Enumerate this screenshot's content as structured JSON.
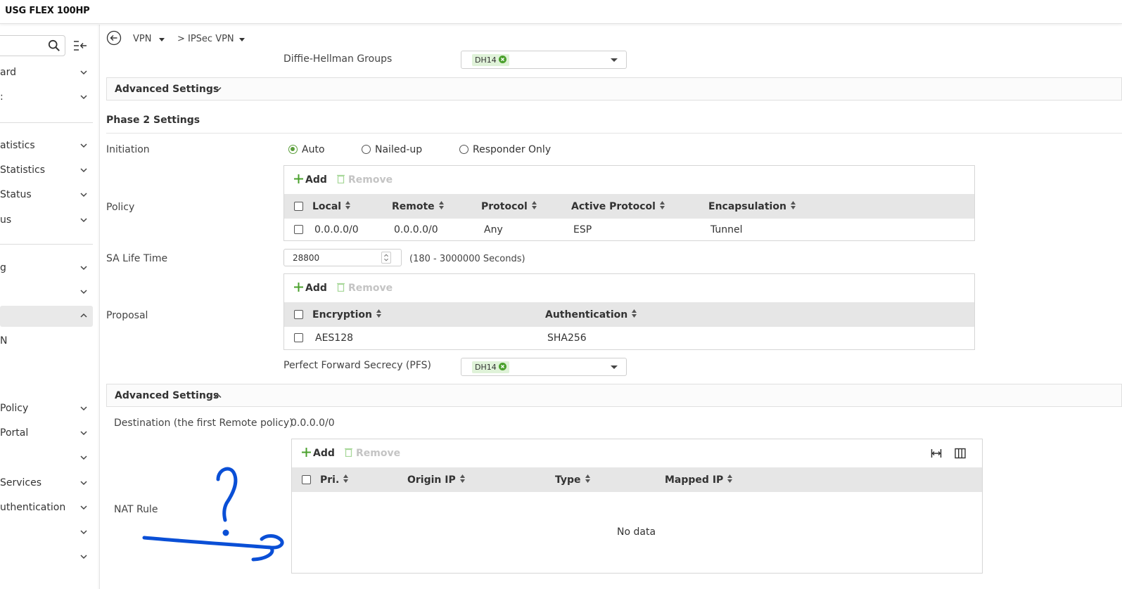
{
  "app": {
    "title": "USG FLEX 100HP"
  },
  "sidebar": {
    "search_placeholder": "",
    "items": [
      {
        "label": "ard",
        "expanded": false
      },
      {
        "label": ":",
        "expanded": false
      },
      {
        "label": "atistics",
        "expanded": false
      },
      {
        "label": "Statistics",
        "expanded": false
      },
      {
        "label": " Status",
        "expanded": false
      },
      {
        "label": "us",
        "expanded": false
      },
      {
        "label": "g",
        "expanded": false
      },
      {
        "label": "",
        "expanded": false
      },
      {
        "label": "",
        "expanded": true,
        "active": true
      },
      {
        "label": "N"
      },
      {
        "label": "Policy",
        "expanded": false
      },
      {
        "label": "Portal",
        "expanded": false
      },
      {
        "label": "",
        "expanded": false
      },
      {
        "label": "Services",
        "expanded": false
      },
      {
        "label": "uthentication",
        "expanded": false
      },
      {
        "label": "",
        "expanded": false
      },
      {
        "label": "",
        "expanded": false
      }
    ]
  },
  "breadcrumb": {
    "first": "VPN",
    "separator": ">",
    "second": "IPSec VPN"
  },
  "phase1": {
    "dh_label": "Diffie-Hellman Groups",
    "dh_value": "DH14"
  },
  "advanced_top": {
    "label": "Advanced Settings"
  },
  "phase2": {
    "title": "Phase 2 Settings",
    "initiation_label": "Initiation",
    "initiation_options": [
      "Auto",
      "Nailed-up",
      "Responder Only"
    ],
    "initiation_selected": "Auto",
    "policy_label": "Policy",
    "policy_table": {
      "add": "Add",
      "remove": "Remove",
      "columns": [
        "Local",
        "Remote",
        "Protocol",
        "Active Protocol",
        "Encapsulation"
      ],
      "rows": [
        [
          "0.0.0.0/0",
          "0.0.0.0/0",
          "Any",
          "ESP",
          "Tunnel"
        ]
      ]
    },
    "sa_label": "SA Life Time",
    "sa_value": "28800",
    "sa_hint": "(180 - 3000000 Seconds)",
    "proposal_label": "Proposal",
    "proposal_table": {
      "add": "Add",
      "remove": "Remove",
      "columns": [
        "Encryption",
        "Authentication"
      ],
      "rows": [
        [
          "AES128",
          "SHA256"
        ]
      ]
    },
    "pfs_label": "Perfect Forward Secrecy (PFS)",
    "pfs_value": "DH14"
  },
  "advanced_bottom": {
    "label": "Advanced Settings",
    "dest_label": "Destination (the first Remote policy)",
    "dest_value": "0.0.0.0/0",
    "nat_label": "NAT Rule",
    "nat_table": {
      "add": "Add",
      "remove": "Remove",
      "columns": [
        "Pri.",
        "Origin IP",
        "Type",
        "Mapped IP"
      ],
      "empty": "No data"
    }
  },
  "annotation": {
    "glyph": "?"
  },
  "colors": {
    "accent_green": "#5a9e3a",
    "tag_bg": "#dff2d8",
    "header_bg": "#e6e6e6",
    "scribble_blue": "#0a4fd6"
  }
}
